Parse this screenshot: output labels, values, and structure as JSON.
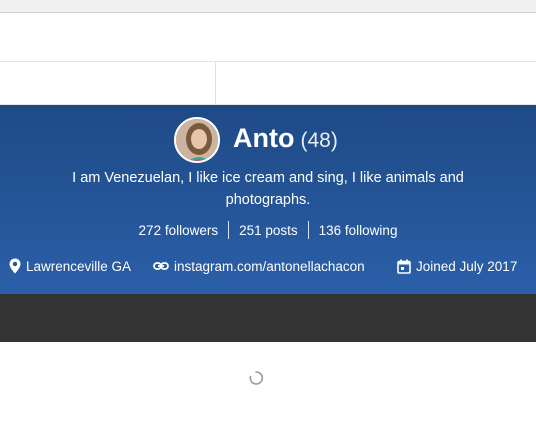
{
  "profile": {
    "name": "Anto",
    "count": "(48)",
    "bio": "I am Venezuelan, I like ice cream and sing, I like animals and photographs.",
    "stats": {
      "followers": "272 followers",
      "posts": "251 posts",
      "following": "136 following"
    },
    "meta": {
      "location": "Lawrenceville GA",
      "link": "instagram.com/antonellachacon",
      "joined": "Joined July 2017"
    }
  },
  "colors": {
    "hero_top": "#1e4a86",
    "hero_bottom": "#2b5fa8",
    "dark_bar": "#333333"
  },
  "icons": {
    "location": "map-pin-icon",
    "link": "link-icon",
    "joined": "calendar-icon",
    "loading": "loading-spinner-icon"
  }
}
